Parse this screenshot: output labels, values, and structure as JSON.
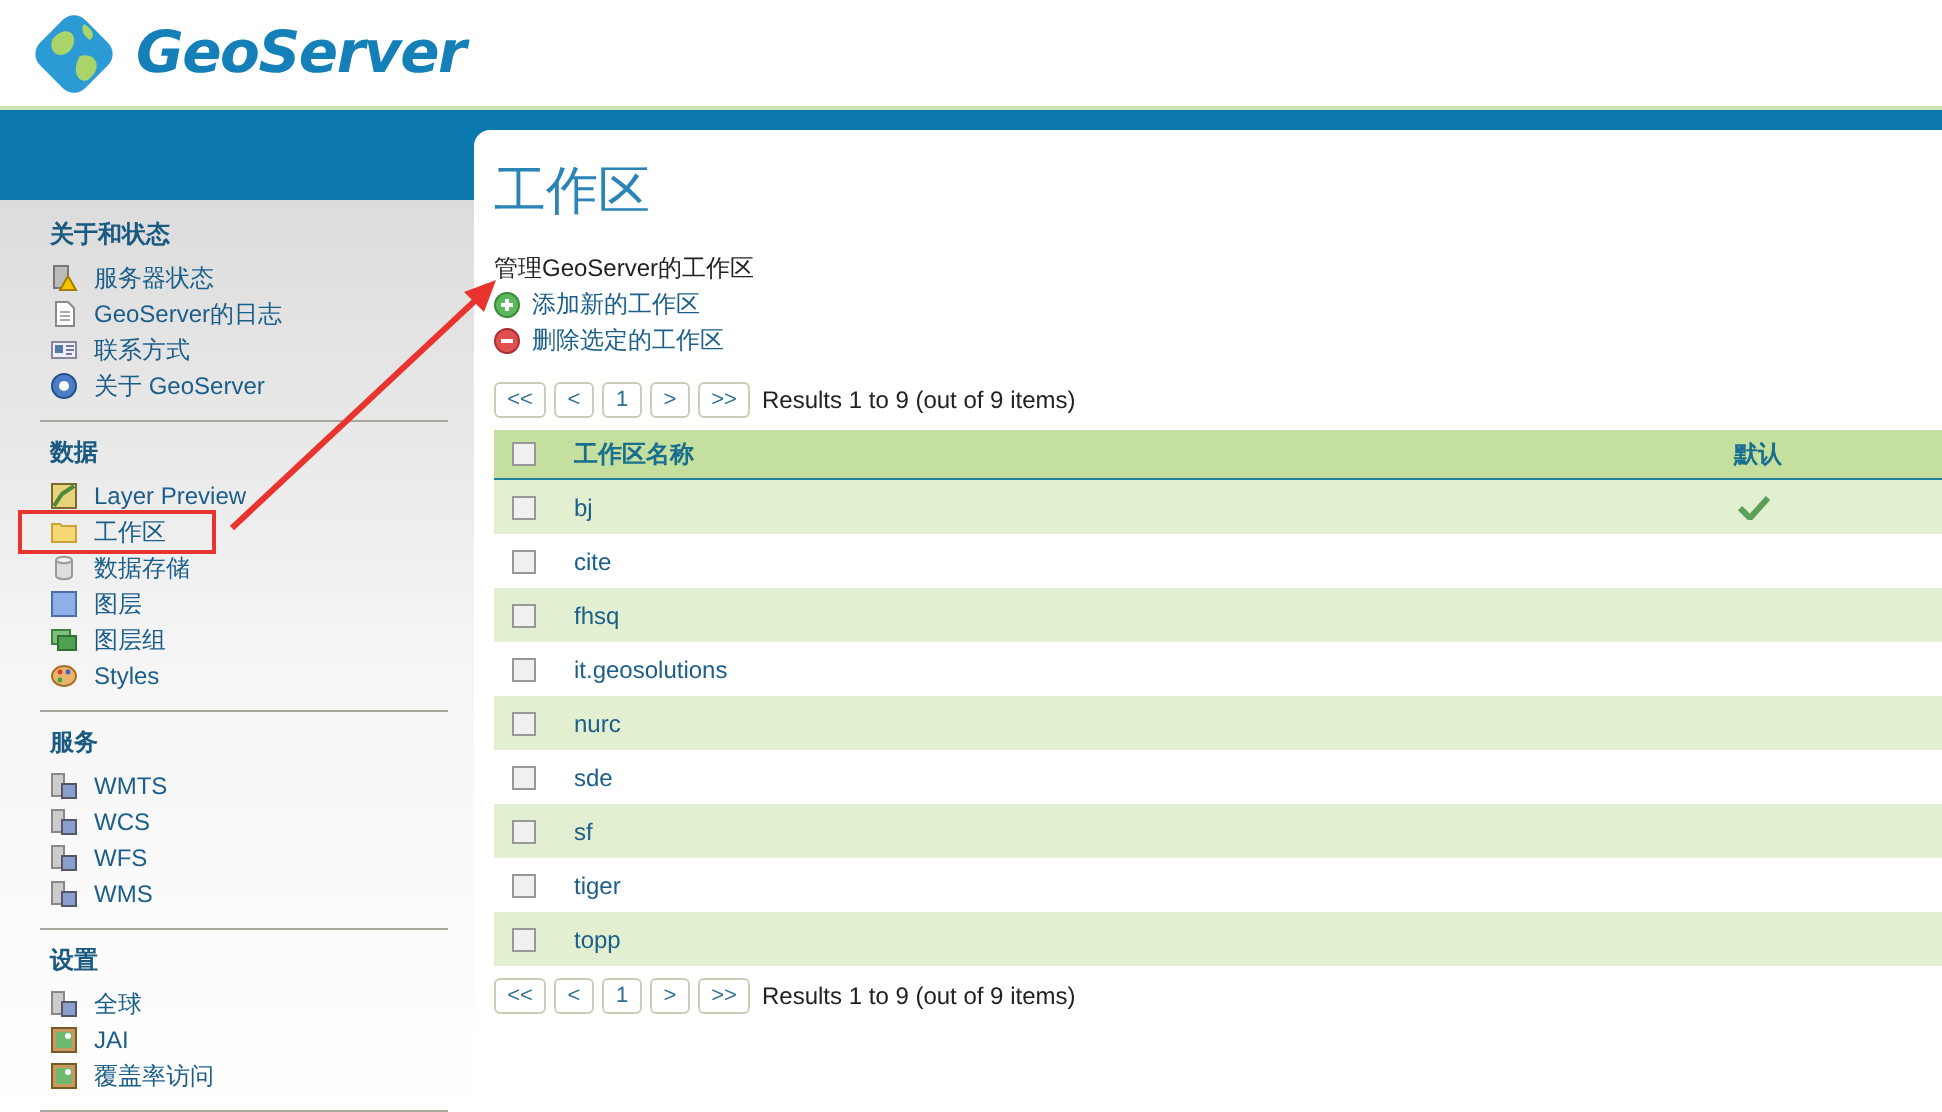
{
  "header": {
    "logo_text": "GeoServer"
  },
  "sidebar": {
    "sections": [
      {
        "title": "关于和状态",
        "items": [
          {
            "label": "服务器状态",
            "highlighted": false
          },
          {
            "label": "GeoServer的日志",
            "highlighted": false
          },
          {
            "label": "联系方式",
            "highlighted": false
          },
          {
            "label": "关于 GeoServer",
            "highlighted": false
          }
        ]
      },
      {
        "title": "数据",
        "items": [
          {
            "label": "Layer Preview",
            "highlighted": false
          },
          {
            "label": "工作区",
            "highlighted": true
          },
          {
            "label": "数据存储",
            "highlighted": false
          },
          {
            "label": "图层",
            "highlighted": false
          },
          {
            "label": "图层组",
            "highlighted": false
          },
          {
            "label": "Styles",
            "highlighted": false
          }
        ]
      },
      {
        "title": "服务",
        "items": [
          {
            "label": "WMTS",
            "highlighted": false
          },
          {
            "label": "WCS",
            "highlighted": false
          },
          {
            "label": "WFS",
            "highlighted": false
          },
          {
            "label": "WMS",
            "highlighted": false
          }
        ]
      },
      {
        "title": "设置",
        "items": [
          {
            "label": "全球",
            "highlighted": false
          },
          {
            "label": "JAI",
            "highlighted": false
          },
          {
            "label": "覆盖率访问",
            "highlighted": false
          }
        ]
      }
    ]
  },
  "content": {
    "title": "工作区",
    "description": "管理GeoServer的工作区",
    "actions": [
      {
        "kind": "add",
        "label": "添加新的工作区"
      },
      {
        "kind": "remove",
        "label": "删除选定的工作区"
      }
    ],
    "pager_top": {
      "buttons": [
        "<<",
        "<",
        "1",
        ">",
        ">>"
      ],
      "summary": "Results 1 to 9 (out of 9 items)"
    },
    "table": {
      "select_all_checked": false,
      "columns": [
        "工作区名称",
        "默认"
      ],
      "rows": [
        {
          "name": "bj",
          "checked": false,
          "default": true
        },
        {
          "name": "cite",
          "checked": false,
          "default": false
        },
        {
          "name": "fhsq",
          "checked": false,
          "default": false
        },
        {
          "name": "it.geosolutions",
          "checked": false,
          "default": false
        },
        {
          "name": "nurc",
          "checked": false,
          "default": false
        },
        {
          "name": "sde",
          "checked": false,
          "default": false
        },
        {
          "name": "sf",
          "checked": false,
          "default": false
        },
        {
          "name": "tiger",
          "checked": false,
          "default": false
        },
        {
          "name": "topp",
          "checked": false,
          "default": false
        }
      ]
    },
    "pager_bottom": {
      "buttons": [
        "<<",
        "<",
        "1",
        ">",
        ">>"
      ],
      "summary": "Results 1 to 9 (out of 9 items)"
    }
  },
  "annotation": {
    "arrow": true
  }
}
